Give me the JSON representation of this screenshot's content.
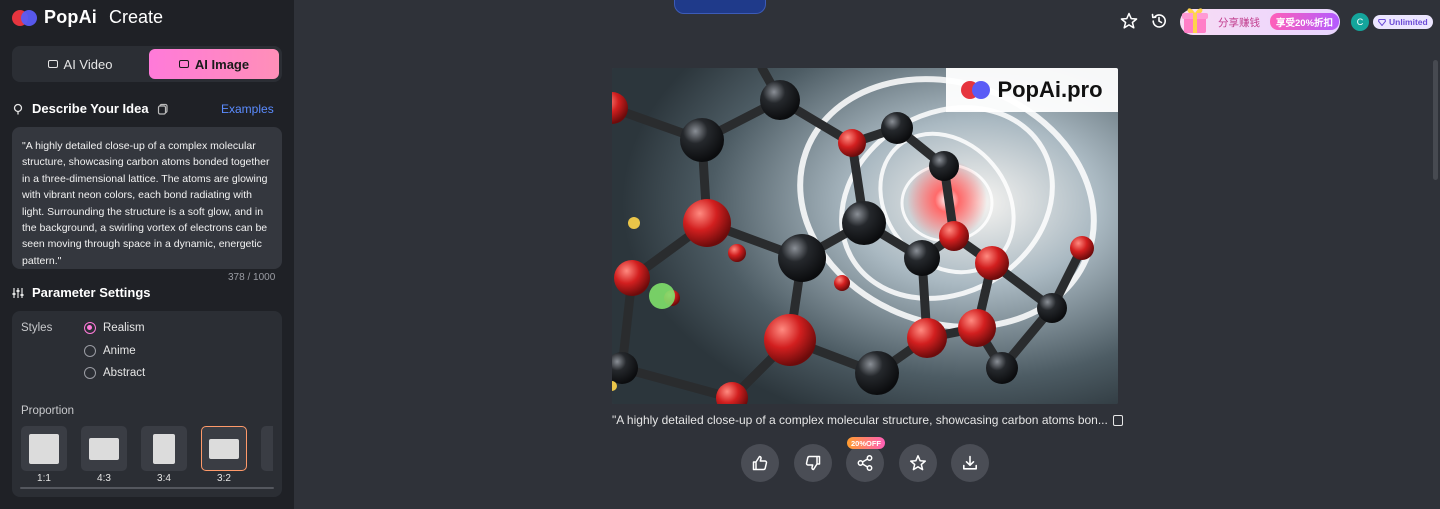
{
  "brand": {
    "name": "PopAi",
    "section": "Create"
  },
  "mode_tabs": [
    {
      "label": "AI Video",
      "active": false
    },
    {
      "label": "AI Image",
      "active": true
    }
  ],
  "describe": {
    "title": "Describe Your Idea",
    "examples_label": "Examples",
    "prompt": "\"A highly detailed close-up of a complex molecular structure, showcasing carbon atoms bonded together in a three-dimensional lattice. The atoms are glowing with vibrant neon colors, each bond radiating with light. Surrounding the structure is a soft glow, and in the background, a swirling vortex of electrons can be seen moving through space in a dynamic, energetic pattern.\"",
    "counter": "378 / 1000"
  },
  "params": {
    "title": "Parameter Settings",
    "styles_label": "Styles",
    "styles": [
      {
        "label": "Realism",
        "selected": true
      },
      {
        "label": "Anime",
        "selected": false
      },
      {
        "label": "Abstract",
        "selected": false
      }
    ],
    "proportion_label": "Proportion",
    "proportions": [
      {
        "label": "1:1",
        "selected": false
      },
      {
        "label": "4:3",
        "selected": false
      },
      {
        "label": "3:4",
        "selected": false
      },
      {
        "label": "3:2",
        "selected": true
      }
    ]
  },
  "topbar": {
    "promo_text": "分享赚钱",
    "promo_badge": "享受20%折扣",
    "avatar_initial": "C",
    "plan_label": "Unlimited",
    "icons": [
      "star-icon",
      "history-icon",
      "gift-icon",
      "diamond-icon"
    ]
  },
  "result": {
    "watermark": "PopAi.pro",
    "caption": "\"A highly detailed close-up of a complex molecular structure, showcasing carbon atoms bon...",
    "share_badge": "20%OFF",
    "actions": [
      "thumbs-up-icon",
      "thumbs-down-icon",
      "share-icon",
      "star-icon",
      "download-icon"
    ]
  },
  "colors": {
    "sidebar_bg": "#1f2126",
    "main_bg": "#2f3239",
    "accent_pink": "#ff7ad9",
    "link_blue": "#5b8cff"
  }
}
